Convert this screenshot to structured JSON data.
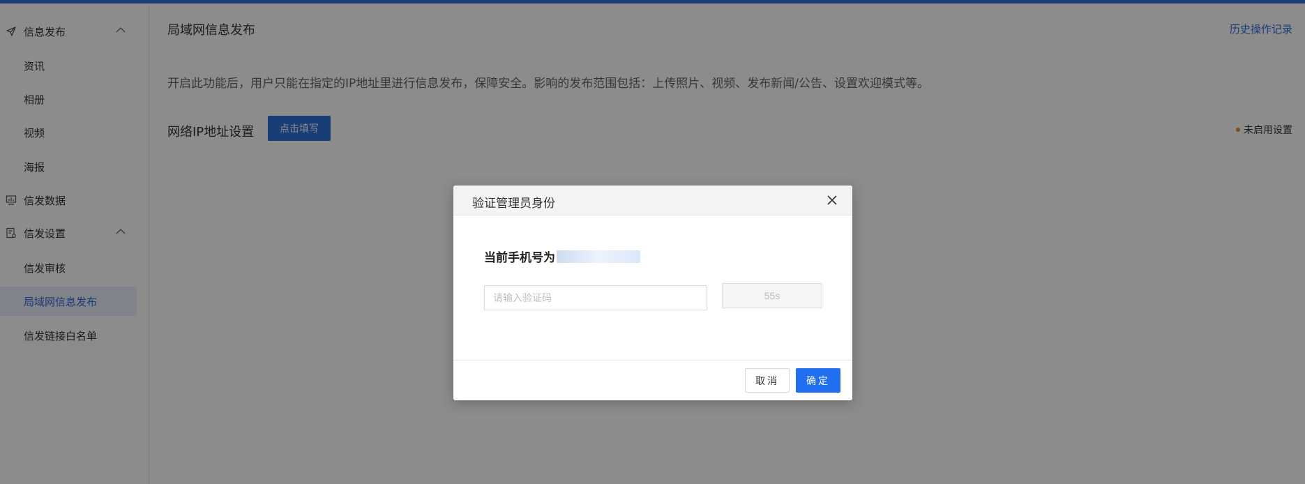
{
  "colors": {
    "accent": "#2f6fd8",
    "primary_button": "#1f6ff0",
    "status_dot": "#e58a2b",
    "active_nav_bg": "#e9eefa"
  },
  "sidebar": {
    "groups": [
      {
        "label": "信息发布",
        "icon": "send-icon",
        "expanded": true,
        "items": [
          "资讯",
          "相册",
          "视频",
          "海报"
        ]
      },
      {
        "label": "信发数据",
        "icon": "monitor-chart-icon"
      },
      {
        "label": "信发设置",
        "icon": "settings-doc-icon",
        "expanded": true,
        "items": [
          "信发审核",
          "局域网信息发布",
          "信发链接白名单"
        ]
      }
    ],
    "active_item": "局域网信息发布"
  },
  "main": {
    "title": "局域网信息发布",
    "history_link": "历史操作记录",
    "description": "开启此功能后，用户只能在指定的IP地址里进行信息发布，保障安全。影响的发布范围包括：上传照片、视频、发布新闻/公告、设置欢迎模式等。",
    "ip_setting_label": "网络IP地址设置",
    "fill_button": "点击填写",
    "status_text": "未启用设置"
  },
  "modal": {
    "title": "验证管理员身份",
    "phone_label": "当前手机号为",
    "code_placeholder": "请输入验证码",
    "code_value": "",
    "countdown": "55s",
    "cancel": "取消",
    "confirm": "确定"
  }
}
